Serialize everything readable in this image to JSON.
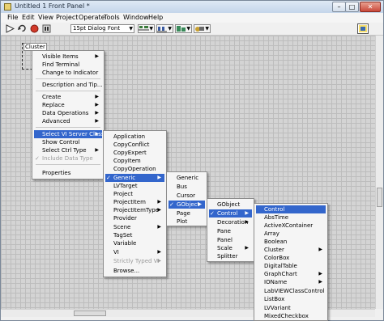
{
  "window": {
    "title": "Untitled 1 Front Panel *",
    "minimize": "–",
    "maximize": "□",
    "close": "✕"
  },
  "menubar": [
    "File",
    "Edit",
    "View",
    "Project",
    "Operate",
    "Tools",
    "Window",
    "Help"
  ],
  "toolbar": {
    "font": "15pt Dialog Font",
    "icons": [
      "run-arrow-icon",
      "run-continuous-icon",
      "abort-icon",
      "pause-icon",
      "text-settings",
      "align-objects-icon",
      "distribute-objects-icon",
      "resize-objects-icon",
      "reorder-icon",
      "vi-icon"
    ]
  },
  "cluster": {
    "label": "Cluster"
  },
  "menu1": {
    "items": [
      {
        "label": "Visible Items",
        "arrow": true
      },
      {
        "label": "Find Terminal"
      },
      {
        "label": "Change to Indicator"
      },
      {
        "label": "Description and Tip..."
      },
      {
        "label": "Create",
        "arrow": true
      },
      {
        "label": "Replace",
        "arrow": true
      },
      {
        "label": "Data Operations",
        "arrow": true
      },
      {
        "label": "Advanced",
        "arrow": true
      },
      {
        "label": "Select VI Server Class",
        "arrow": true,
        "highlight": true
      },
      {
        "label": "Show Control"
      },
      {
        "label": "Select Ctrl Type",
        "arrow": true
      },
      {
        "label": "Include Data Type",
        "disabled": true,
        "check": true
      },
      {
        "label": "Properties"
      }
    ]
  },
  "menu2": {
    "items": [
      {
        "label": "Application"
      },
      {
        "label": "CopyConflict"
      },
      {
        "label": "CopyExpert"
      },
      {
        "label": "CopyItem"
      },
      {
        "label": "CopyOperation"
      },
      {
        "label": "Generic",
        "arrow": true,
        "highlight": true,
        "check": true
      },
      {
        "label": "LVTarget"
      },
      {
        "label": "Project"
      },
      {
        "label": "ProjectItem",
        "arrow": true
      },
      {
        "label": "ProjectItemType",
        "arrow": true
      },
      {
        "label": "Provider"
      },
      {
        "label": "Scene",
        "arrow": true
      },
      {
        "label": "TagSet"
      },
      {
        "label": "Variable"
      },
      {
        "label": "VI",
        "arrow": true
      },
      {
        "label": "Strictly Typed VI",
        "arrow": true,
        "disabled": true
      },
      {
        "label": "Browse..."
      }
    ]
  },
  "menu3": {
    "items": [
      {
        "label": "Generic"
      },
      {
        "label": "Bus"
      },
      {
        "label": "Cursor"
      },
      {
        "label": "GObject",
        "arrow": true,
        "highlight": true,
        "check": true
      },
      {
        "label": "Page"
      },
      {
        "label": "Plot"
      }
    ]
  },
  "menu4": {
    "items": [
      {
        "label": "GObject"
      },
      {
        "label": "Control",
        "arrow": true,
        "highlight": true,
        "check": true
      },
      {
        "label": "Decoration",
        "arrow": true
      },
      {
        "label": "Pane"
      },
      {
        "label": "Panel"
      },
      {
        "label": "Scale",
        "arrow": true
      },
      {
        "label": "Splitter"
      }
    ]
  },
  "menu5": {
    "items": [
      {
        "label": "Control",
        "highlight": true
      },
      {
        "label": "AbsTime"
      },
      {
        "label": "ActiveXContainer"
      },
      {
        "label": "Array"
      },
      {
        "label": "Boolean"
      },
      {
        "label": "Cluster",
        "arrow": true
      },
      {
        "label": "ColorBox"
      },
      {
        "label": "DigitalTable"
      },
      {
        "label": "GraphChart",
        "arrow": true
      },
      {
        "label": "IOName",
        "arrow": true
      },
      {
        "label": "LabVIEWClassControl"
      },
      {
        "label": "ListBox"
      },
      {
        "label": "LVVariant"
      },
      {
        "label": "MixedCheckbox"
      }
    ]
  }
}
